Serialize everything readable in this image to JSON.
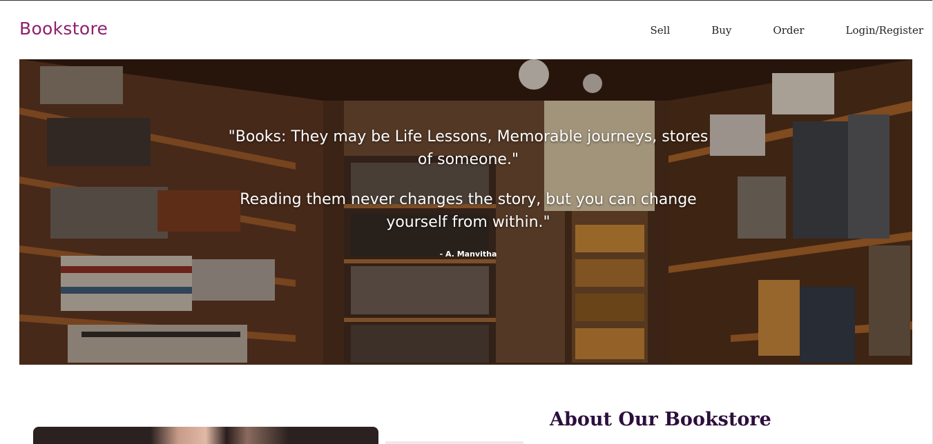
{
  "header": {
    "brand": "Bookstore",
    "nav": {
      "sell": "Sell",
      "buy": "Buy",
      "order": "Order",
      "login": "Login/Register"
    }
  },
  "hero": {
    "quote_line1": "\"Books: They may be Life Lessons, Memorable journeys, stores of someone.\"",
    "quote_line2": "Reading them never changes the story, but you can change yourself from within.\"",
    "author": "- A. Manvitha"
  },
  "about": {
    "title": "About Our Bookstore"
  },
  "colors": {
    "brand": "#8e1f6c",
    "about_title": "#2c0f3e"
  }
}
